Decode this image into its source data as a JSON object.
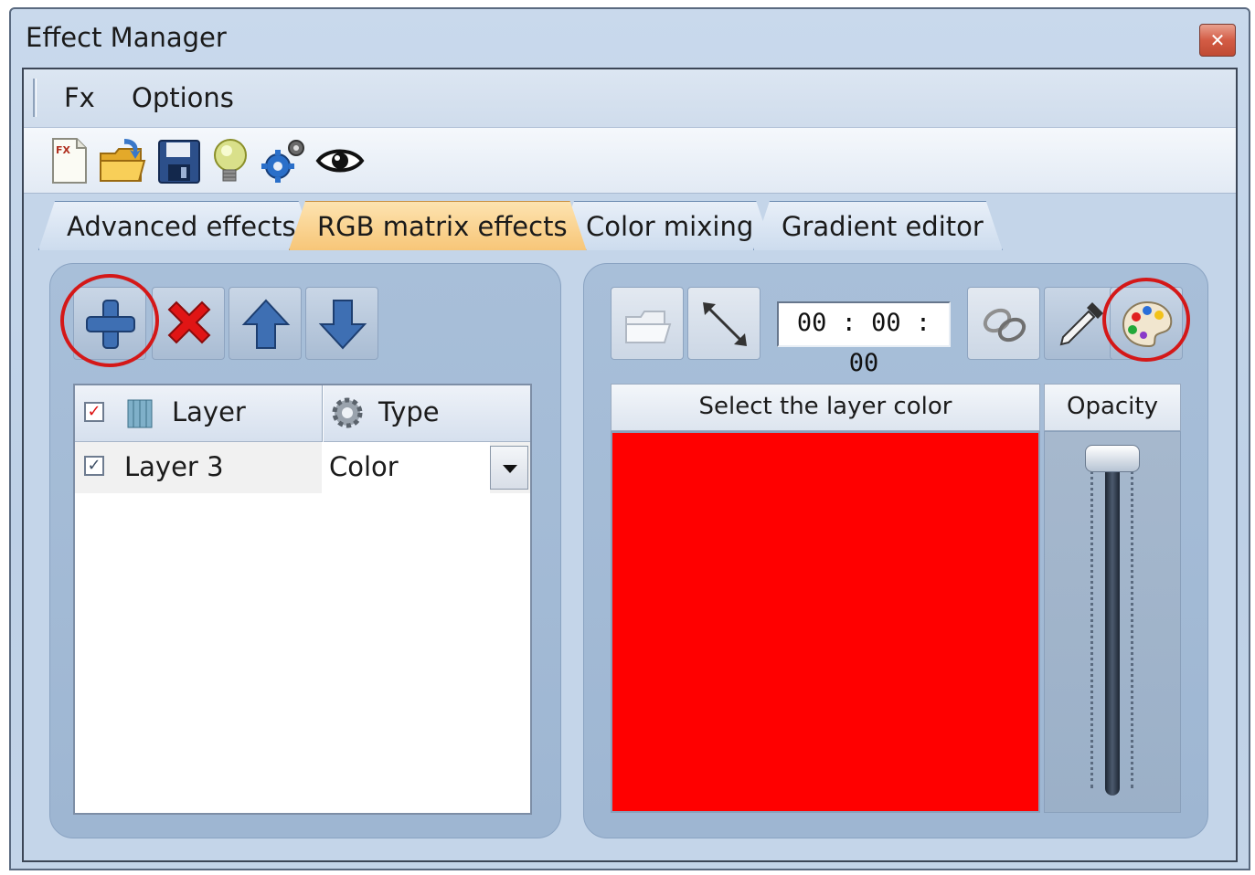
{
  "window": {
    "title": "Effect Manager",
    "close_icon": "close-icon"
  },
  "menu": {
    "items": [
      "Fx",
      "Options"
    ]
  },
  "toolbar": {
    "icons": [
      "new-effect-icon",
      "open-folder-icon",
      "save-icon",
      "lightbulb-icon",
      "settings-gears-icon",
      "preview-eye-icon"
    ]
  },
  "tabs": {
    "items": [
      "Advanced effects",
      "RGB matrix effects",
      "Color mixing",
      "Gradient editor"
    ],
    "active": "RGB matrix effects"
  },
  "layers_panel": {
    "buttons": [
      "add-layer-icon",
      "delete-layer-icon",
      "move-up-icon",
      "move-down-icon"
    ],
    "grid": {
      "columns": [
        "Layer",
        "Type"
      ],
      "rows": [
        {
          "checked": true,
          "layer": "Layer 3",
          "type": "Color"
        }
      ]
    }
  },
  "color_panel": {
    "time": "00 : 00 : 00",
    "color_header": "Select the layer color",
    "opacity_header": "Opacity",
    "selected_color": "#ff0000",
    "opacity_percent": 100
  },
  "highlight_color": "#d41818"
}
